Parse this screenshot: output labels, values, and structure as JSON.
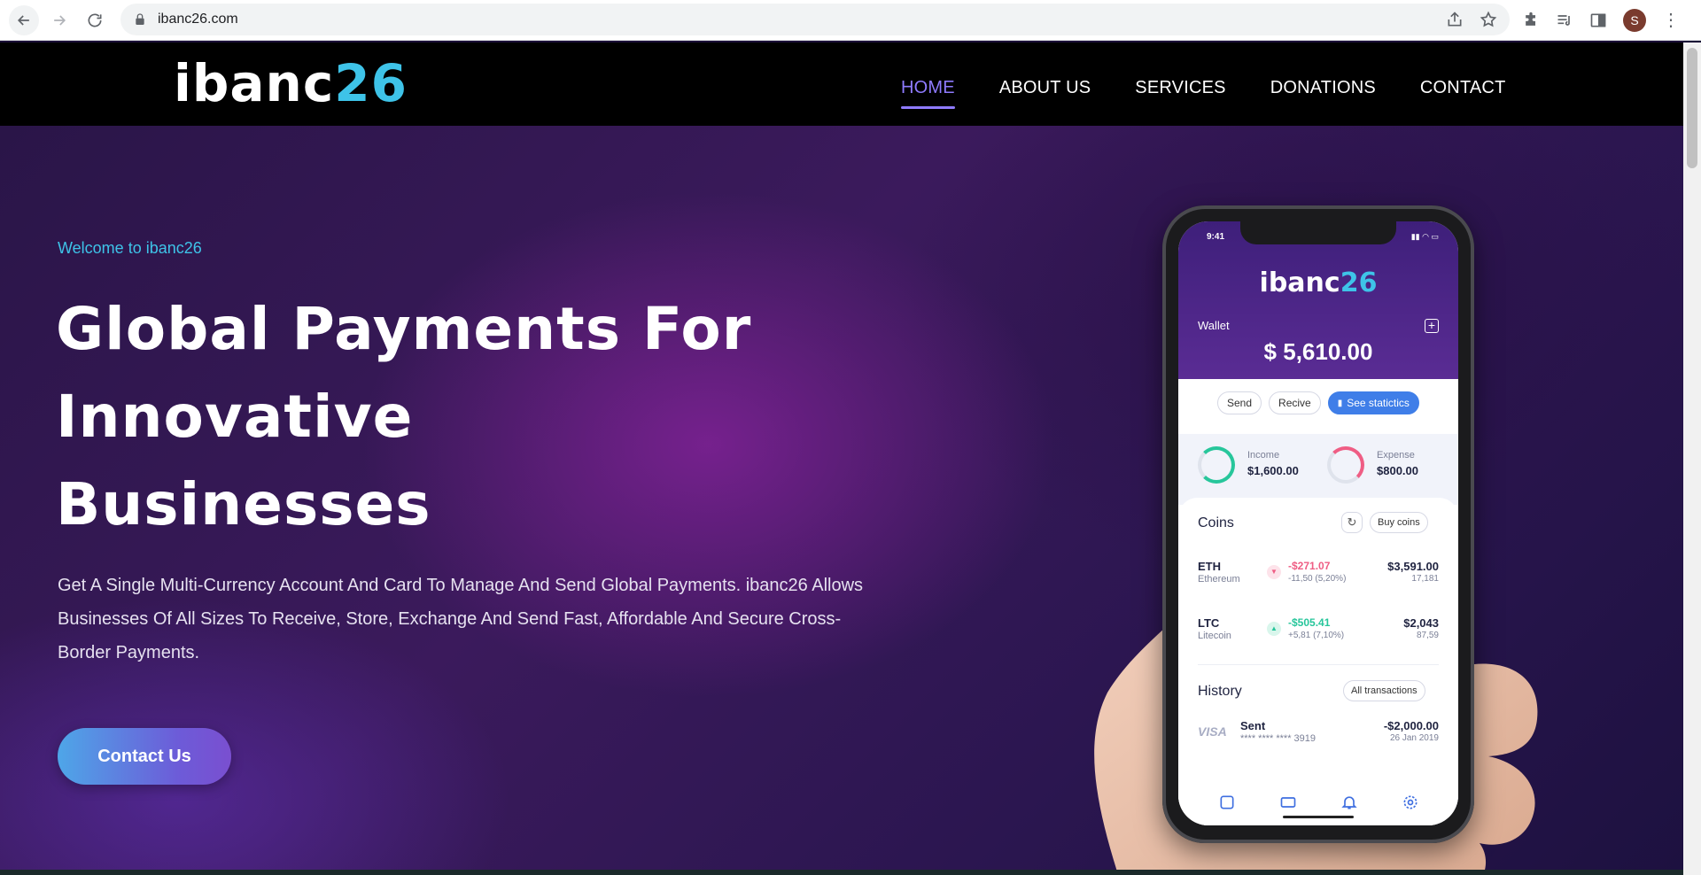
{
  "browser": {
    "url": "ibanc26.com",
    "avatar_initial": "S"
  },
  "header": {
    "logo_part1": "ibanc",
    "logo_part2": "26",
    "nav": [
      {
        "label": "HOME",
        "active": true
      },
      {
        "label": "ABOUT US",
        "active": false
      },
      {
        "label": "SERVICES",
        "active": false
      },
      {
        "label": "DONATIONS",
        "active": false
      },
      {
        "label": "CONTACT",
        "active": false
      }
    ]
  },
  "hero": {
    "welcome": "Welcome to ibanc26",
    "headline_lines": [
      "Global Payments For",
      "Innovative",
      "Businesses"
    ],
    "description": "Get A Single Multi-Currency Account And Card To Manage And Send Global Payments. ibanc26 Allows Businesses Of All Sizes To Receive, Store, Exchange And Send Fast, Affordable And Secure Cross-Border Payments.",
    "cta_label": "Contact Us"
  },
  "phone": {
    "time": "9:41",
    "logo_part1": "ibanc",
    "logo_part2": "26",
    "wallet_label": "Wallet",
    "balance": "$ 5,610.00",
    "actions": [
      "Send",
      "Recive",
      "See statictics"
    ],
    "income_label": "Income",
    "income_value": "$1,600.00",
    "expense_label": "Expense",
    "expense_value": "$800.00",
    "coins_title": "Coins",
    "buy_coins": "Buy coins",
    "coins": [
      {
        "symbol": "ETH",
        "name": "Ethereum",
        "change": "-$271.07",
        "change_sub": "-11,50 (5,20%)",
        "amount": "$3,591.00",
        "amount_sub": "17,181"
      },
      {
        "symbol": "LTC",
        "name": "Litecoin",
        "change": "-$505.41",
        "change_sub": "+5,81 (7,10%)",
        "amount": "$2,043",
        "amount_sub": "87,59"
      }
    ],
    "history_title": "History",
    "all_transactions": "All transactions",
    "history": [
      {
        "card": "VISA",
        "title": "Sent",
        "number": "**** **** **** 3919",
        "amount": "-$2,000.00",
        "date": "26 Jan 2019"
      }
    ]
  },
  "colors": {
    "accent": "#3ec3e8",
    "nav_active": "#8f7bff",
    "positive": "#27c69b",
    "negative": "#ef5d84"
  }
}
